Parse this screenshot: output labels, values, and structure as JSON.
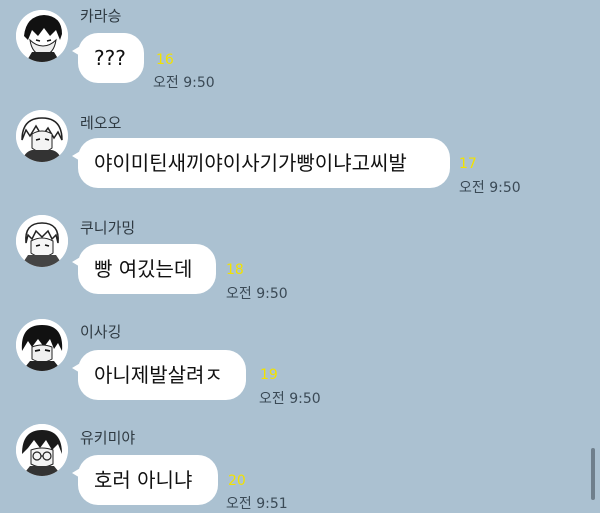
{
  "messages": [
    {
      "sender": "카라승",
      "text": "???",
      "unread": "16",
      "time": "오전 9:50",
      "avatar_icon": "karasu-avatar-icon"
    },
    {
      "sender": "레오오",
      "text": "야이미틴새끼야이사기가빵이냐고씨발",
      "unread": "17",
      "time": "오전 9:50",
      "avatar_icon": "reo-avatar-icon"
    },
    {
      "sender": "쿠니가밍",
      "text": "빵 여깄는데",
      "unread": "18",
      "time": "오전 9:50",
      "avatar_icon": "kunigami-avatar-icon"
    },
    {
      "sender": "이사깅",
      "text": "아니제발살려ㅈ",
      "unread": "19",
      "time": "오전 9:50",
      "avatar_icon": "isagi-avatar-icon"
    },
    {
      "sender": "유키미야",
      "text": "호러 아니냐",
      "unread": "20",
      "time": "오전 9:51",
      "avatar_icon": "yukimiya-avatar-icon"
    }
  ],
  "colors": {
    "background": "#abc1d1",
    "bubble": "#ffffff",
    "unread_count": "#f2e200"
  }
}
